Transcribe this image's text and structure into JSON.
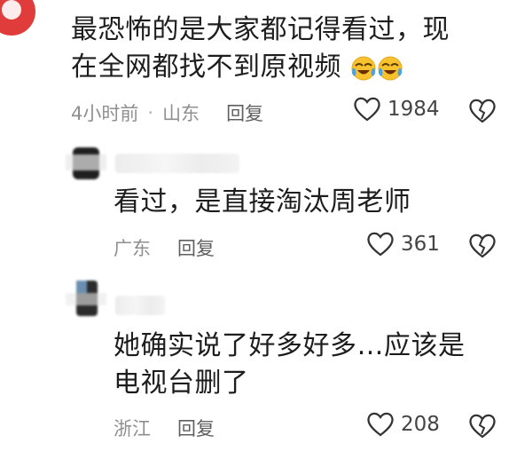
{
  "comments": [
    {
      "text_line1": "最恐怖的是大家都记得看过，现",
      "text_line2": "在全网都找不到原视频",
      "time": "4小时前",
      "separator": "·",
      "location": "山东",
      "reply_label": "回复",
      "likes": "1984",
      "emojis": [
        "laughing-crying-emoji",
        "laughing-crying-emoji"
      ]
    },
    {
      "text_line1": "看过，是直接淘汰周老师",
      "location": "广东",
      "reply_label": "回复",
      "likes": "361"
    },
    {
      "text_line1": "她确实说了好多好多…应该是",
      "text_line2": "电视台删了",
      "location": "浙江",
      "reply_label": "回复",
      "likes": "208"
    }
  ],
  "colors": {
    "accent_red": "#e03c3c",
    "text": "#1d1d1d",
    "meta": "#8f8f8f",
    "emoji_yellow": "#f7c22d",
    "emoji_blue": "#4aa3e0"
  }
}
